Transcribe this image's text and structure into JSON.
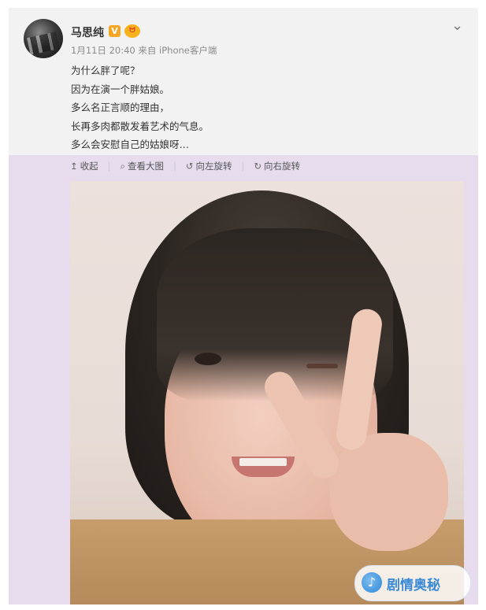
{
  "post": {
    "username": "马思纯",
    "verified_badge": "V",
    "vip_badge": "ᗢ",
    "meta": "1月11日 20:40 来自 iPhone客户端",
    "lines": [
      "为什么胖了呢？",
      "因为在演一个胖姑娘。",
      "多么名正言顺的理由，",
      "长再多肉都散发着艺术的气息。",
      "多么会安慰自己的姑娘呀…"
    ],
    "more_icon": "chevron-down-icon"
  },
  "toolbar": {
    "collapse": {
      "icon": "↥",
      "label": "收起"
    },
    "view_large": {
      "icon": "⌕",
      "label": "查看大图"
    },
    "rotate_left": {
      "icon": "↺",
      "label": "向左旋转"
    },
    "rotate_right": {
      "icon": "↻",
      "label": "向右旋转"
    }
  },
  "watermark": {
    "logo_glyph": "♪",
    "text": "剧情奥秘"
  },
  "colors": {
    "header_bg": "#f2f2f2",
    "media_bg": "#e6dced",
    "text": "#333333",
    "meta": "#8a8a8a",
    "badge": "#f5a623",
    "watermark": "#3a8ad6"
  }
}
